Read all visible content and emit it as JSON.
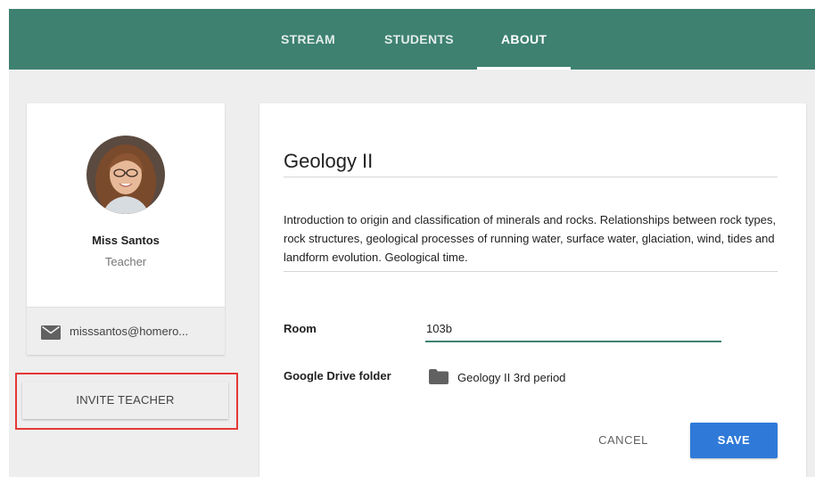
{
  "tabs": [
    {
      "label": "STREAM",
      "active": false
    },
    {
      "label": "STUDENTS",
      "active": false
    },
    {
      "label": "ABOUT",
      "active": true
    }
  ],
  "teacher": {
    "name": "Miss Santos",
    "role": "Teacher",
    "email": "misssantos@homero..."
  },
  "invite_button": "INVITE TEACHER",
  "class": {
    "title": "Geology II",
    "description": "Introduction to origin and classification of minerals and rocks. Relationships between rock types, rock structures, geological processes of running water, surface water, glaciation, wind, tides and landform evolution. Geological time.",
    "room_label": "Room",
    "room_value": "103b",
    "drive_label": "Google Drive folder",
    "drive_folder": "Geology II 3rd period"
  },
  "actions": {
    "cancel": "CANCEL",
    "save": "SAVE"
  },
  "colors": {
    "topbar": "#3e8170",
    "save_button": "#2f7ad8",
    "highlight_box": "#e53935"
  }
}
